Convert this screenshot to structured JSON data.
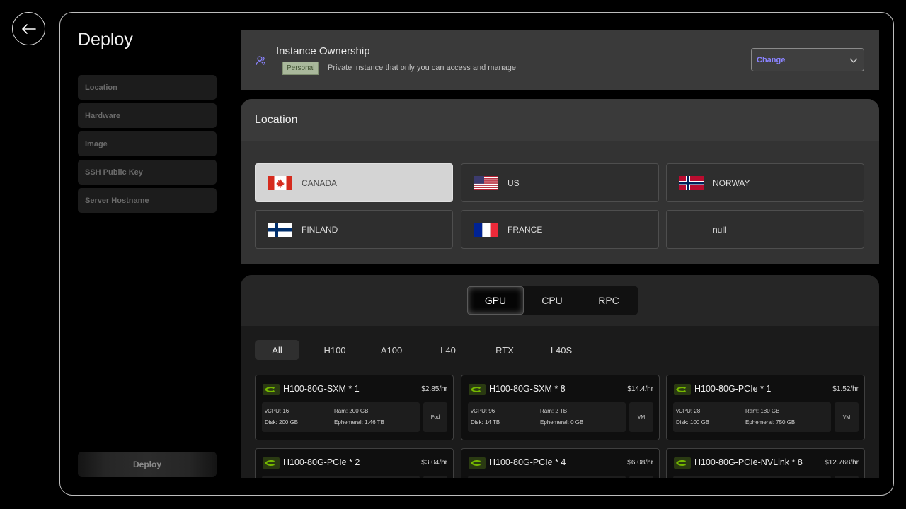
{
  "page": {
    "title": "Deploy"
  },
  "sidebar": {
    "items": [
      {
        "label": "Location"
      },
      {
        "label": "Hardware"
      },
      {
        "label": "Image"
      },
      {
        "label": "SSH Public Key"
      },
      {
        "label": "Server Hostname"
      }
    ],
    "deploy_label": "Deploy"
  },
  "ownership": {
    "title": "Instance Ownership",
    "badge": "Personal",
    "description": "Private instance that only you can access and manage",
    "change_label": "Change"
  },
  "location": {
    "title": "Location",
    "options": [
      {
        "name": "CANADA",
        "flag": "canada-flag",
        "selected": true
      },
      {
        "name": "US",
        "flag": "us-flag",
        "selected": false
      },
      {
        "name": "NORWAY",
        "flag": "norway-flag",
        "selected": false
      },
      {
        "name": "FINLAND",
        "flag": "finland-flag",
        "selected": false
      },
      {
        "name": "FRANCE",
        "flag": "france-flag",
        "selected": false
      },
      {
        "name": "null",
        "flag": "",
        "selected": false
      }
    ]
  },
  "hardware": {
    "tabs": [
      {
        "label": "GPU",
        "active": true
      },
      {
        "label": "CPU"
      },
      {
        "label": "RPC"
      }
    ],
    "filters": [
      {
        "label": "All",
        "active": true
      },
      {
        "label": "H100"
      },
      {
        "label": "A100"
      },
      {
        "label": "L40"
      },
      {
        "label": "RTX"
      },
      {
        "label": "L40S"
      }
    ],
    "cards": [
      {
        "name": "H100-80G-SXM * 1",
        "price": "$2.85/hr",
        "vcpu": "vCPU: 16",
        "ram": "Ram: 200 GB",
        "disk": "Disk: 200 GB",
        "ephemeral": "Ephemeral: 1.46 TB",
        "type": "Pod"
      },
      {
        "name": "H100-80G-SXM * 8",
        "price": "$14.4/hr",
        "vcpu": "vCPU: 96",
        "ram": "Ram: 2 TB",
        "disk": "Disk: 14 TB",
        "ephemeral": "Ephemeral: 0 GB",
        "type": "VM"
      },
      {
        "name": "H100-80G-PCIe * 1",
        "price": "$1.52/hr",
        "vcpu": "vCPU: 28",
        "ram": "Ram: 180 GB",
        "disk": "Disk: 100 GB",
        "ephemeral": "Ephemeral: 750 GB",
        "type": "VM"
      },
      {
        "name": "H100-80G-PCIe * 2",
        "price": "$3.04/hr"
      },
      {
        "name": "H100-80G-PCIe * 4",
        "price": "$6.08/hr"
      },
      {
        "name": "H100-80G-PCIe-NVLink * 8",
        "price": "$12.768/hr"
      }
    ]
  },
  "colors": {
    "accent": "#8a83ff",
    "badge_bg": "#a9b89b",
    "nvidia_green": "#76b900"
  }
}
